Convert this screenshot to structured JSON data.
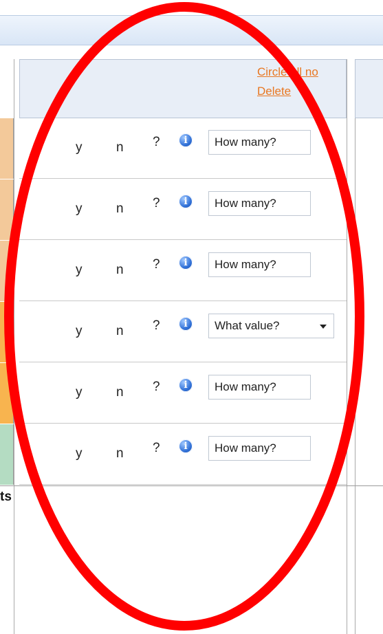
{
  "header": {
    "circle_all_no_label": "Circle all no",
    "delete_label": "Delete"
  },
  "rows": [
    {
      "y": "y",
      "n": "n",
      "q": "?",
      "info": "i",
      "field_type": "text",
      "field_value": "How many?",
      "swatch": "#f3c99a"
    },
    {
      "y": "y",
      "n": "n",
      "q": "?",
      "info": "i",
      "field_type": "text",
      "field_value": "How many?",
      "swatch": "#f3c99a"
    },
    {
      "y": "y",
      "n": "n",
      "q": "?",
      "info": "i",
      "field_type": "text",
      "field_value": "How many?",
      "swatch": "#f3c99a"
    },
    {
      "y": "y",
      "n": "n",
      "q": "?",
      "info": "i",
      "field_type": "select",
      "field_value": "What value?",
      "swatch": "#f8b44f"
    },
    {
      "y": "y",
      "n": "n",
      "q": "?",
      "info": "i",
      "field_type": "text",
      "field_value": "How many?",
      "swatch": "#f8b44f"
    },
    {
      "y": "y",
      "n": "n",
      "q": "?",
      "info": "i",
      "field_type": "text",
      "field_value": "How many?",
      "swatch": "#b4dcc2"
    }
  ],
  "footer_label": "ts",
  "annotation": {
    "color": "#ff0000"
  }
}
